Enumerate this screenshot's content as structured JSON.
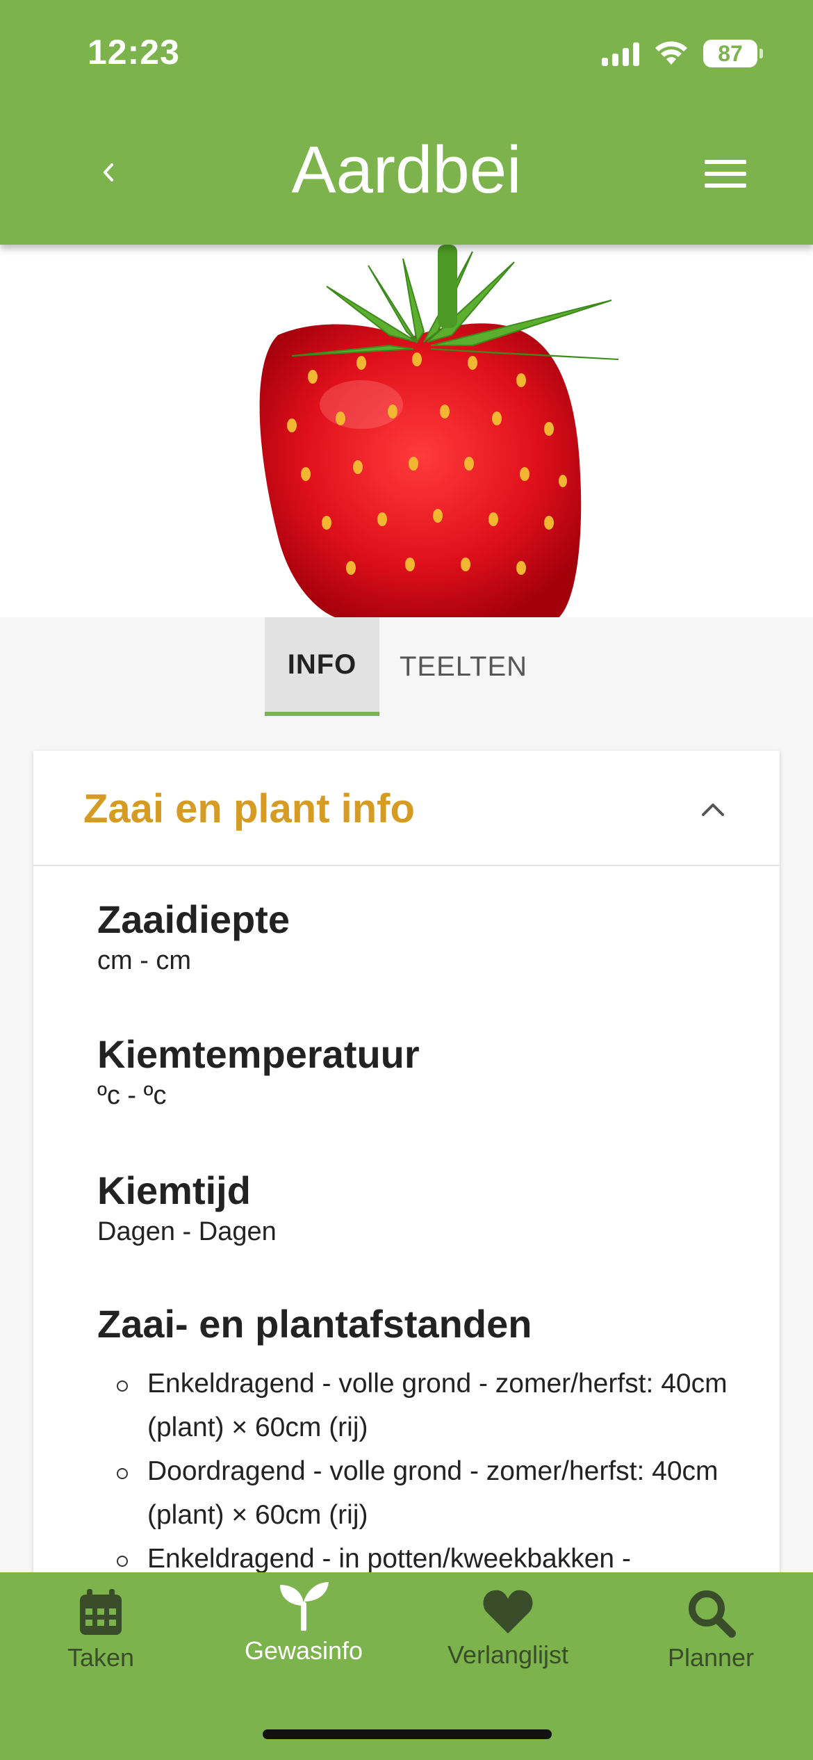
{
  "status_bar": {
    "time": "12:23",
    "battery": "87"
  },
  "header": {
    "title": "Aardbei"
  },
  "hero": {
    "image_alt": "strawberry"
  },
  "tabs": [
    {
      "label": "INFO",
      "active": true
    },
    {
      "label": "TEELTEN",
      "active": false
    }
  ],
  "card": {
    "title": "Zaai en plant info",
    "sections": [
      {
        "heading": "Zaaidiepte",
        "value": "cm - cm"
      },
      {
        "heading": "Kiemtemperatuur",
        "value": "ºc - ºc"
      },
      {
        "heading": "Kiemtijd",
        "value": "Dagen - Dagen"
      }
    ],
    "spacing": {
      "heading": "Zaai- en plantafstanden",
      "items": [
        "Enkeldragend - volle grond - zomer/herfst: 40cm (plant) × 60cm (rij)",
        "Doordragend - volle grond - zomer/herfst: 40cm (plant) × 60cm (rij)",
        "Enkeldragend - in potten/kweekbakken -"
      ]
    }
  },
  "bottom_nav": [
    {
      "label": "Taken",
      "icon": "calendar-icon",
      "active": false
    },
    {
      "label": "Gewasinfo",
      "icon": "sprout-icon",
      "active": true
    },
    {
      "label": "Verlanglijst",
      "icon": "heart-icon",
      "active": false
    },
    {
      "label": "Planner",
      "icon": "search-icon",
      "active": false
    }
  ],
  "colors": {
    "primary": "#7db34d",
    "accent": "#d59b22",
    "nav_inactive": "#3a4d2a"
  }
}
